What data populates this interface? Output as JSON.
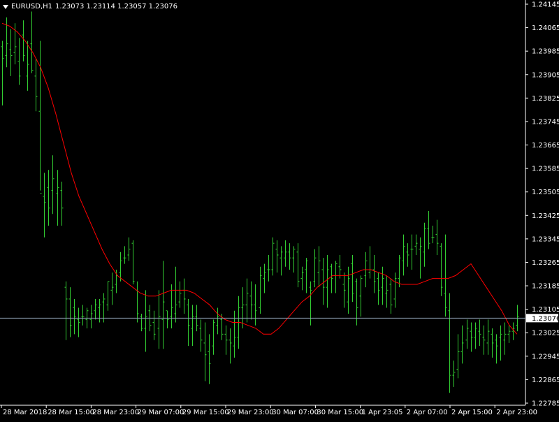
{
  "header": {
    "symbol_tf": "EURUSD,H1",
    "ohlc": "1.23073 1.23114 1.23057 1.23076"
  },
  "colors": {
    "background": "#000000",
    "axis": "#ffffff",
    "bars": "#32cd32",
    "ma": "#ff0000",
    "bid_line": "#8fa2b6"
  },
  "chart_data": {
    "type": "ohlc",
    "yticks": [
      "1.24145",
      "1.24065",
      "1.23985",
      "1.23905",
      "1.23825",
      "1.23745",
      "1.23665",
      "1.23585",
      "1.23505",
      "1.23425",
      "1.23345",
      "1.23265",
      "1.23185",
      "1.23105",
      "1.23025",
      "1.22945",
      "1.22865",
      "1.22785"
    ],
    "xticks": [
      "28 Mar 2018",
      "28 Mar 15:00",
      "28 Mar 23:00",
      "29 Mar 07:00",
      "29 Mar 15:00",
      "29 Mar 23:00",
      "30 Mar 07:00",
      "30 Mar 15:00",
      "1 Apr 23:05",
      "2 Apr 07:00",
      "2 Apr 15:00",
      "2 Apr 23:00"
    ],
    "ylim": [
      1.22785,
      1.24145
    ],
    "current_price": "1.23076",
    "series": [
      {
        "name": "EURUSD,H1",
        "values": [
          [
            1.24,
            1.2402,
            1.238,
            1.2396
          ],
          [
            1.2397,
            1.241,
            1.2393,
            1.2401
          ],
          [
            1.2399,
            1.2406,
            1.239,
            1.2397
          ],
          [
            1.2398,
            1.2408,
            1.2394,
            1.24
          ],
          [
            1.2395,
            1.2403,
            1.2387,
            1.239
          ],
          [
            1.2404,
            1.2409,
            1.2395,
            1.2397
          ],
          [
            1.239,
            1.2402,
            1.2385,
            1.2394
          ],
          [
            1.2401,
            1.2412,
            1.2391,
            1.2392
          ],
          [
            1.239,
            1.2396,
            1.2378,
            1.2383
          ],
          [
            1.2378,
            1.2402,
            1.2351,
            1.235
          ],
          [
            1.2349,
            1.2357,
            1.2335,
            1.2347
          ],
          [
            1.2352,
            1.2358,
            1.2339,
            1.2345
          ],
          [
            1.2351,
            1.2363,
            1.2343,
            1.2355
          ],
          [
            1.235,
            1.2358,
            1.2339,
            1.2352
          ],
          [
            1.2351,
            1.2354,
            1.2339,
            1.2345
          ],
          [
            1.2318,
            1.232,
            1.23,
            1.2314
          ],
          [
            1.2314,
            1.2318,
            1.2301,
            1.2305
          ],
          [
            1.2311,
            1.2314,
            1.2302,
            1.2308
          ],
          [
            1.2307,
            1.2311,
            1.2301,
            1.2306
          ],
          [
            1.2308,
            1.2312,
            1.2305,
            1.2308
          ],
          [
            1.2307,
            1.2311,
            1.2304,
            1.231
          ],
          [
            1.2307,
            1.2312,
            1.2304,
            1.2309
          ],
          [
            1.231,
            1.2314,
            1.2307,
            1.2312
          ],
          [
            1.2311,
            1.2314,
            1.2306,
            1.2312
          ],
          [
            1.2313,
            1.2316,
            1.2306,
            1.2314
          ],
          [
            1.2312,
            1.232,
            1.231,
            1.232
          ],
          [
            1.2317,
            1.2323,
            1.2312,
            1.2318
          ],
          [
            1.2319,
            1.2324,
            1.2316,
            1.2322
          ],
          [
            1.2323,
            1.233,
            1.232,
            1.2327
          ],
          [
            1.2328,
            1.2332,
            1.2326,
            1.2328
          ],
          [
            1.2329,
            1.2335,
            1.2327,
            1.2331
          ],
          [
            1.2333,
            1.2334,
            1.2319,
            1.232
          ],
          [
            1.2317,
            1.232,
            1.2306,
            1.2309
          ],
          [
            1.2308,
            1.2309,
            1.2303,
            1.2304
          ],
          [
            1.2304,
            1.2317,
            1.2296,
            1.2308
          ],
          [
            1.231,
            1.2312,
            1.2303,
            1.2305
          ],
          [
            1.2306,
            1.231,
            1.23,
            1.2302
          ],
          [
            1.2304,
            1.2317,
            1.2297,
            1.2308
          ],
          [
            1.2307,
            1.2327,
            1.2297,
            1.2313
          ],
          [
            1.231,
            1.231,
            1.2304,
            1.2307
          ],
          [
            1.2308,
            1.2319,
            1.2304,
            1.2311
          ],
          [
            1.2309,
            1.2325,
            1.2306,
            1.2312
          ],
          [
            1.2313,
            1.232,
            1.2311,
            1.2316
          ],
          [
            1.2317,
            1.2321,
            1.2309,
            1.2314
          ],
          [
            1.2312,
            1.2314,
            1.2298,
            1.2305
          ],
          [
            1.2304,
            1.2312,
            1.2298,
            1.2308
          ],
          [
            1.2308,
            1.2312,
            1.2303,
            1.2305
          ],
          [
            1.2304,
            1.2307,
            1.2296,
            1.23
          ],
          [
            1.2299,
            1.2306,
            1.2286,
            1.2295
          ],
          [
            1.2296,
            1.2302,
            1.2285,
            1.2292
          ],
          [
            1.2298,
            1.2307,
            1.2295,
            1.2306
          ],
          [
            1.2305,
            1.2311,
            1.2302,
            1.2308
          ],
          [
            1.2307,
            1.2309,
            1.23,
            1.2302
          ],
          [
            1.2302,
            1.2305,
            1.2295,
            1.23
          ],
          [
            1.23,
            1.2304,
            1.2292,
            1.2299
          ],
          [
            1.2298,
            1.231,
            1.2294,
            1.2301
          ],
          [
            1.2301,
            1.2315,
            1.2297,
            1.2311
          ],
          [
            1.2311,
            1.2318,
            1.2304,
            1.2312
          ],
          [
            1.2312,
            1.2321,
            1.2306,
            1.2316
          ],
          [
            1.2315,
            1.232,
            1.2307,
            1.2312
          ],
          [
            1.2312,
            1.2319,
            1.2305,
            1.231
          ],
          [
            1.2311,
            1.2325,
            1.2309,
            1.2322
          ],
          [
            1.2321,
            1.2326,
            1.2316,
            1.2323
          ],
          [
            1.2324,
            1.2329,
            1.232,
            1.2324
          ],
          [
            1.2324,
            1.2335,
            1.2322,
            1.2333
          ],
          [
            1.2331,
            1.2334,
            1.2323,
            1.2329
          ],
          [
            1.2328,
            1.2332,
            1.2322,
            1.233
          ],
          [
            1.2328,
            1.2334,
            1.2325,
            1.233
          ],
          [
            1.233,
            1.2333,
            1.2324,
            1.2328
          ],
          [
            1.2328,
            1.2332,
            1.2323,
            1.2331
          ],
          [
            1.233,
            1.2333,
            1.2318,
            1.232
          ],
          [
            1.2321,
            1.2325,
            1.2317,
            1.2323
          ],
          [
            1.2324,
            1.2328,
            1.2316,
            1.2327
          ],
          [
            1.2318,
            1.232,
            1.2305,
            1.2317
          ],
          [
            1.232,
            1.2331,
            1.2318,
            1.2328
          ],
          [
            1.2323,
            1.2332,
            1.2318,
            1.2327
          ],
          [
            1.2324,
            1.2328,
            1.2312,
            1.2318
          ],
          [
            1.2318,
            1.2329,
            1.2311,
            1.2324
          ],
          [
            1.2325,
            1.2326,
            1.2316,
            1.2321
          ],
          [
            1.2322,
            1.2327,
            1.2316,
            1.2326
          ],
          [
            1.2325,
            1.2329,
            1.2321,
            1.2324
          ],
          [
            1.2319,
            1.2323,
            1.2311,
            1.2317
          ],
          [
            1.2313,
            1.2325,
            1.2309,
            1.2321
          ],
          [
            1.2326,
            1.2329,
            1.2313,
            1.2316
          ],
          [
            1.232,
            1.2321,
            1.2305,
            1.2311
          ],
          [
            1.2315,
            1.2322,
            1.2308,
            1.2321
          ],
          [
            1.2322,
            1.233,
            1.2318,
            1.2327
          ],
          [
            1.2323,
            1.2332,
            1.2321,
            1.2324
          ],
          [
            1.2324,
            1.2329,
            1.2316,
            1.232
          ],
          [
            1.2321,
            1.2323,
            1.2312,
            1.2317
          ],
          [
            1.2318,
            1.2325,
            1.2312,
            1.2321
          ],
          [
            1.2316,
            1.2322,
            1.2311,
            1.2317
          ],
          [
            1.2319,
            1.2321,
            1.2309,
            1.2312
          ],
          [
            1.2314,
            1.2323,
            1.2311,
            1.2321
          ],
          [
            1.2321,
            1.2329,
            1.2318,
            1.2328
          ],
          [
            1.2327,
            1.2336,
            1.2322,
            1.2332
          ],
          [
            1.233,
            1.2333,
            1.2325,
            1.2329
          ],
          [
            1.2331,
            1.2336,
            1.2324,
            1.2331
          ],
          [
            1.2332,
            1.2336,
            1.2329,
            1.2333
          ],
          [
            1.2331,
            1.2335,
            1.2321,
            1.2332
          ],
          [
            1.233,
            1.234,
            1.2325,
            1.2338
          ],
          [
            1.2338,
            1.2344,
            1.2331,
            1.2333
          ],
          [
            1.2335,
            1.2339,
            1.2333,
            1.2335
          ],
          [
            1.2336,
            1.2341,
            1.2329,
            1.2333
          ],
          [
            1.2332,
            1.2333,
            1.2315,
            1.2318
          ],
          [
            1.2316,
            1.2336,
            1.2308,
            1.2311
          ],
          [
            1.231,
            1.2316,
            1.2282,
            1.2288
          ],
          [
            1.2288,
            1.2293,
            1.2284,
            1.2289
          ],
          [
            1.229,
            1.2302,
            1.2287,
            1.2296
          ],
          [
            1.2296,
            1.2305,
            1.2292,
            1.2299
          ],
          [
            1.23,
            1.2307,
            1.2297,
            1.2304
          ],
          [
            1.2303,
            1.2306,
            1.2296,
            1.2301
          ],
          [
            1.2301,
            1.2306,
            1.2297,
            1.2304
          ],
          [
            1.2303,
            1.2307,
            1.2298,
            1.2302
          ],
          [
            1.2301,
            1.2305,
            1.2295,
            1.23
          ],
          [
            1.2299,
            1.2307,
            1.2295,
            1.2303
          ],
          [
            1.2302,
            1.2304,
            1.2294,
            1.2299
          ],
          [
            1.23,
            1.2302,
            1.2292,
            1.2298
          ],
          [
            1.2301,
            1.2305,
            1.2293,
            1.2302
          ],
          [
            1.23,
            1.2306,
            1.2295,
            1.2302
          ],
          [
            1.2302,
            1.2305,
            1.2299,
            1.2303
          ],
          [
            1.2303,
            1.2306,
            1.23,
            1.2304
          ],
          [
            1.2305,
            1.2312,
            1.2303,
            1.2308
          ]
        ]
      },
      {
        "name": "MA",
        "values": [
          1.2408,
          1.2407,
          1.2405,
          1.2402,
          1.2398,
          1.2393,
          1.2386,
          1.2377,
          1.2367,
          1.2357,
          1.2349,
          1.2343,
          1.2337,
          1.2331,
          1.2326,
          1.2322,
          1.232,
          1.2318,
          1.2316,
          1.2315,
          1.2315,
          1.2316,
          1.2317,
          1.2317,
          1.2317,
          1.2316,
          1.2314,
          1.2312,
          1.2309,
          1.2307,
          1.2306,
          1.2306,
          1.2305,
          1.2304,
          1.2302,
          1.2302,
          1.2304,
          1.2307,
          1.231,
          1.2313,
          1.2315,
          1.2318,
          1.232,
          1.2322,
          1.2322,
          1.2322,
          1.2323,
          1.2324,
          1.2324,
          1.2323,
          1.2322,
          1.232,
          1.2319,
          1.2319,
          1.2319,
          1.232,
          1.2321,
          1.2321,
          1.2321,
          1.2322,
          1.2324,
          1.2326,
          1.2322,
          1.2318,
          1.2314,
          1.231,
          1.2305,
          1.2302
        ]
      }
    ]
  }
}
